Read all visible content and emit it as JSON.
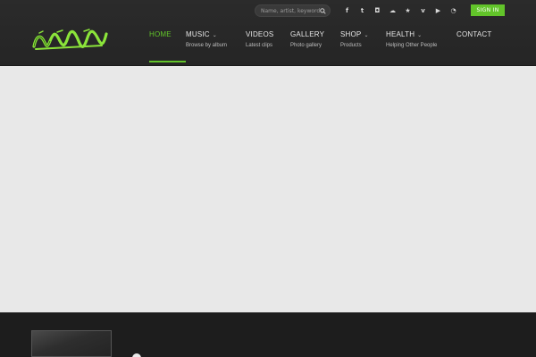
{
  "search": {
    "placeholder": "Name, artist, keyword"
  },
  "social": [
    {
      "icon": "facebook-icon",
      "glyph": "f"
    },
    {
      "icon": "twitter-icon",
      "glyph": "t"
    },
    {
      "icon": "instagram-icon",
      "glyph": "◘"
    },
    {
      "icon": "soundcloud-icon",
      "glyph": "☁"
    },
    {
      "icon": "star-icon",
      "glyph": "★"
    },
    {
      "icon": "vimeo-icon",
      "glyph": "v"
    },
    {
      "icon": "youtube-icon",
      "glyph": "▶"
    },
    {
      "icon": "rss-icon",
      "glyph": "◔"
    }
  ],
  "signin_label": "SIGN IN",
  "nav": {
    "home": {
      "label": "HOME"
    },
    "music": {
      "label": "MUSIC",
      "sub": "Browse by album"
    },
    "videos": {
      "label": "VIDEOS",
      "sub": "Latest clips"
    },
    "gallery": {
      "label": "GALLERY",
      "sub": "Photo gallery"
    },
    "shop": {
      "label": "SHOP",
      "sub": "Products"
    },
    "health": {
      "label": "HEALTH",
      "sub": "Helping Other People"
    },
    "contact": {
      "label": "CONTACT"
    }
  },
  "colors": {
    "accent": "#62c42a",
    "header": "#282828",
    "content": "#e8e8e8",
    "footer": "#1d1d1d"
  }
}
